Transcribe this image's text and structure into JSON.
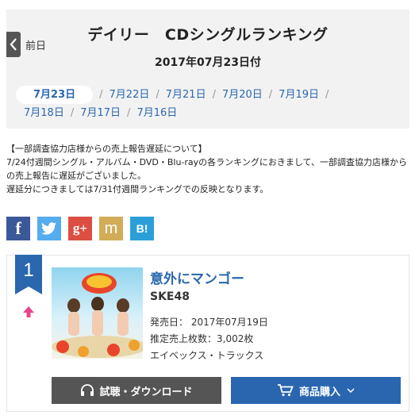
{
  "header": {
    "prev_label": "前日",
    "title": "デイリー　CDシングルランキング",
    "subtitle": "2017年07月23日付",
    "dates": [
      "7月23日",
      "7月22日",
      "7月21日",
      "7月20日",
      "7月19日",
      "7月18日",
      "7月17日",
      "7月16日"
    ],
    "active_date": "7月23日"
  },
  "notice": {
    "heading": "【一部調査協力店様からの売上報告遅延について】",
    "line1": "7/24付週間シングル・アルバム・DVD・Blu-rayの各ランキングにおきまして、一部調査協力店様からの売上報告に遅延がございました。",
    "line2": "遅延分につきましては7/31付週間ランキングでの反映となります。"
  },
  "share": [
    {
      "name": "facebook",
      "glyph": "f",
      "color": "#3b5998"
    },
    {
      "name": "twitter",
      "glyph": "t",
      "color": "#55acee"
    },
    {
      "name": "google-plus",
      "glyph": "g+",
      "color": "#dc4e41"
    },
    {
      "name": "mixi",
      "glyph": "m",
      "color": "#d1ad59"
    },
    {
      "name": "hatena",
      "glyph": "B!",
      "color": "#2c9fd8"
    }
  ],
  "entry": {
    "rank": "1",
    "trend": "up",
    "title": "意外にマンゴー",
    "artist": "SKE48",
    "release": "発売日：  2017年07月19日",
    "sales": "推定売上枚数：3,002枚",
    "label": "エイベックス・トラックス",
    "download_label": "試聴・ダウンロード",
    "buy_label": "商品購入"
  },
  "colors": {
    "accent": "#2b67ae",
    "trend_up": "#e8448a",
    "dark_button": "#555555"
  }
}
